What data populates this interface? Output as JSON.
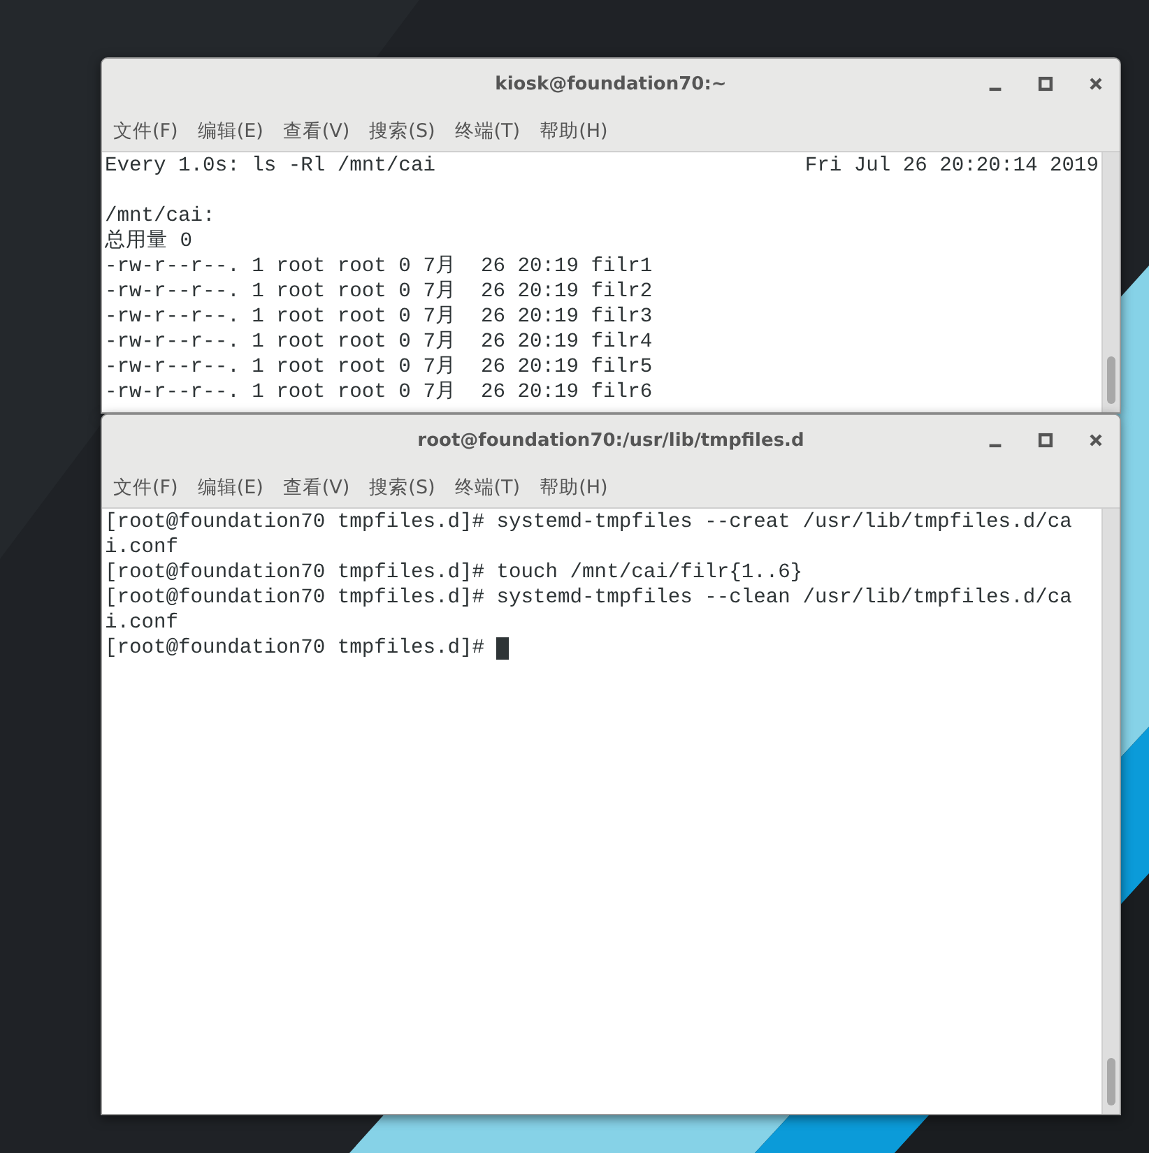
{
  "windows": [
    {
      "title": "kiosk@foundation70:~",
      "menu": [
        "文件(F)",
        "编辑(E)",
        "查看(V)",
        "搜索(S)",
        "终端(T)",
        "帮助(H)"
      ],
      "terminal": {
        "header": {
          "command": "Every 1.0s: ls -Rl /mnt/cai",
          "time": "Fri Jul 26 20:20:14 2019"
        },
        "lines": [
          "/mnt/cai:",
          "总用量 0",
          "-rw-r--r--. 1 root root 0 7月  26 20:19 filr1",
          "-rw-r--r--. 1 root root 0 7月  26 20:19 filr2",
          "-rw-r--r--. 1 root root 0 7月  26 20:19 filr3",
          "-rw-r--r--. 1 root root 0 7月  26 20:19 filr4",
          "-rw-r--r--. 1 root root 0 7月  26 20:19 filr5",
          "-rw-r--r--. 1 root root 0 7月  26 20:19 filr6"
        ]
      }
    },
    {
      "title": "root@foundation70:/usr/lib/tmpfiles.d",
      "menu": [
        "文件(F)",
        "编辑(E)",
        "查看(V)",
        "搜索(S)",
        "终端(T)",
        "帮助(H)"
      ],
      "terminal": {
        "lines": [
          "[root@foundation70 tmpfiles.d]# systemd-tmpfiles --creat /usr/lib/tmpfiles.d/ca",
          "i.conf",
          "[root@foundation70 tmpfiles.d]# touch /mnt/cai/filr{1..6}",
          "[root@foundation70 tmpfiles.d]# systemd-tmpfiles --clean /usr/lib/tmpfiles.d/ca",
          "i.conf",
          "[root@foundation70 tmpfiles.d]# "
        ],
        "cursor": true
      }
    }
  ]
}
